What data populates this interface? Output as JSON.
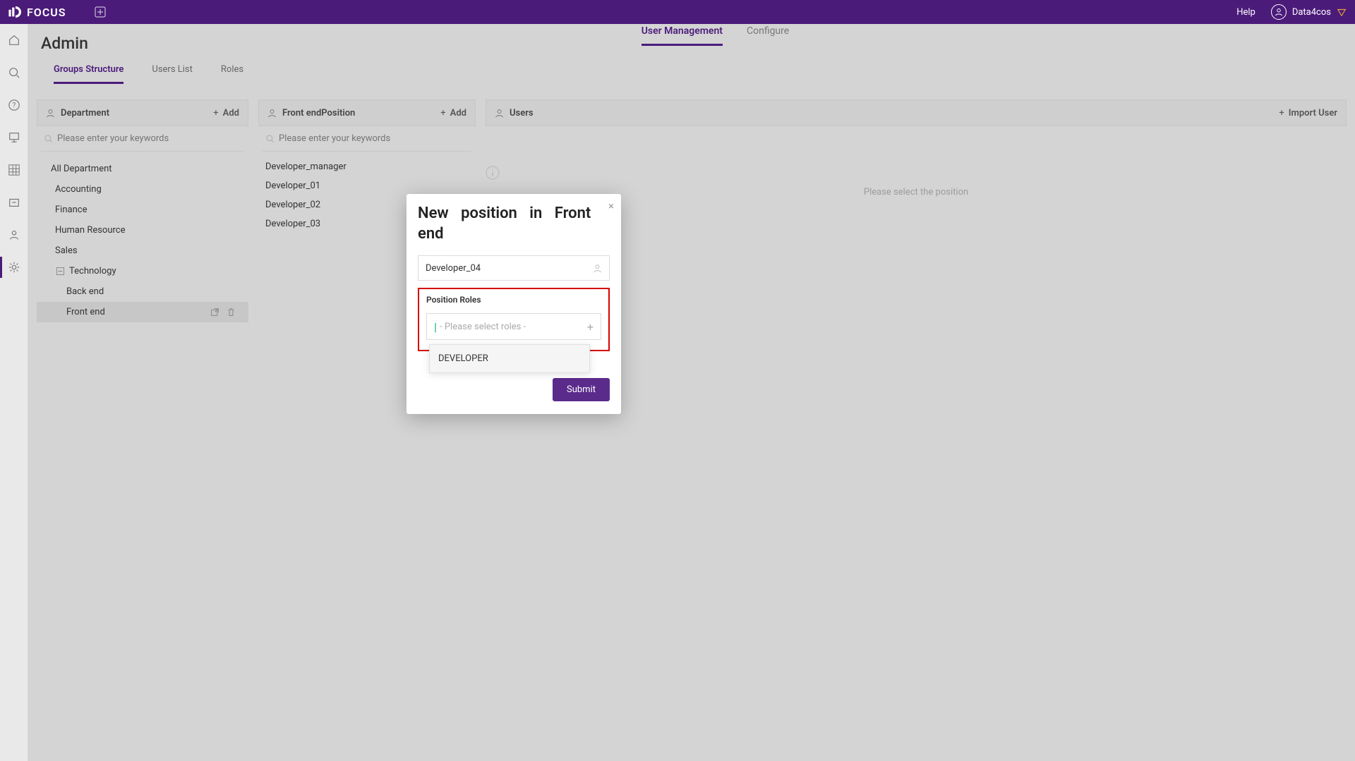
{
  "header": {
    "brand": "FOCUS",
    "help": "Help",
    "username": "Data4cos"
  },
  "page": {
    "title": "Admin",
    "main_tabs": {
      "user_mgmt": "User Management",
      "configure": "Configure"
    },
    "sub_tabs": {
      "groups": "Groups Structure",
      "users": "Users List",
      "roles": "Roles"
    }
  },
  "dept_col": {
    "title": "Department",
    "add": "Add",
    "search_ph": "Please enter your keywords",
    "items": {
      "all": "All Department",
      "accounting": "Accounting",
      "finance": "Finance",
      "hr": "Human Resource",
      "sales": "Sales",
      "technology": "Technology",
      "backend": "Back end",
      "frontend": "Front end"
    }
  },
  "pos_col": {
    "title": "Front endPosition",
    "add": "Add",
    "search_ph": "Please enter your keywords",
    "items": [
      "Developer_manager",
      "Developer_01",
      "Developer_02",
      "Developer_03"
    ]
  },
  "users_col": {
    "title": "Users",
    "import": "Import User",
    "empty": "Please select the position"
  },
  "modal": {
    "title": "New position in Front　end",
    "name_value": "Developer_04",
    "roles_label": "Position Roles",
    "roles_placeholder": "- Please select roles -",
    "roles_options": [
      "DEVELOPER"
    ],
    "submit": "Submit"
  }
}
